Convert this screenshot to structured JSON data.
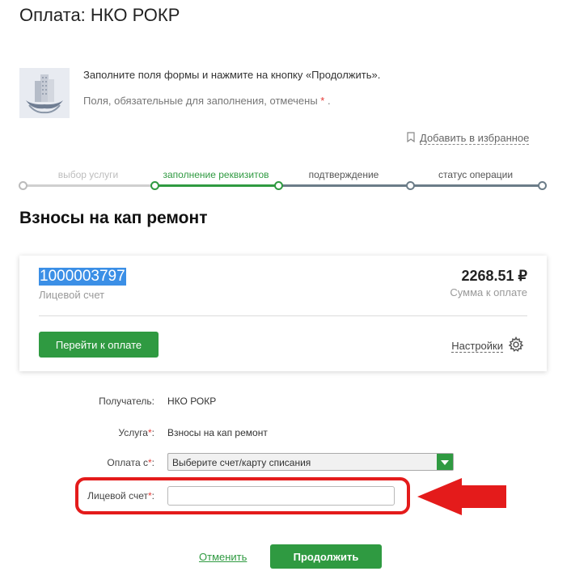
{
  "page": {
    "title": "Оплата: НКО РОКР"
  },
  "info": {
    "instruction": "Заполните поля формы и нажмите на кнопку «Продолжить».",
    "required_note": "Поля, обязательные для заполнения, отмечены",
    "required_star": "*",
    "required_end": " ."
  },
  "favorites": {
    "label": "Добавить в избранное"
  },
  "steps": [
    {
      "label": "выбор услуги",
      "state": "done"
    },
    {
      "label": "заполнение реквизитов",
      "state": "active"
    },
    {
      "label": "подтверждение",
      "state": "pending"
    },
    {
      "label": "статус операции",
      "state": "pending"
    }
  ],
  "section": {
    "title": "Взносы на кап ремонт"
  },
  "card": {
    "account_number": "1000003797",
    "account_caption": "Лицевой счет",
    "sum": "2268.51 ₽",
    "sum_caption": "Сумма к оплате",
    "pay_button": "Перейти к оплате",
    "settings_label": "Настройки"
  },
  "form": {
    "recipient_label": "Получатель:",
    "recipient_value": "НКО РОКР",
    "service_label": "Услуга",
    "service_value": "Взносы на кап ремонт",
    "payment_label": "Оплата с",
    "payment_placeholder": "Выберите счет/карту списания",
    "account_label": "Лицевой счет",
    "account_value": "",
    "star": "*",
    "colon": ":"
  },
  "actions": {
    "cancel": "Отменить",
    "continue": "Продолжить"
  },
  "colors": {
    "accent": "#2f9a41",
    "highlight": "#e41b1b",
    "step_pending": "#6b7c88",
    "step_done": "#cfcfcf"
  }
}
